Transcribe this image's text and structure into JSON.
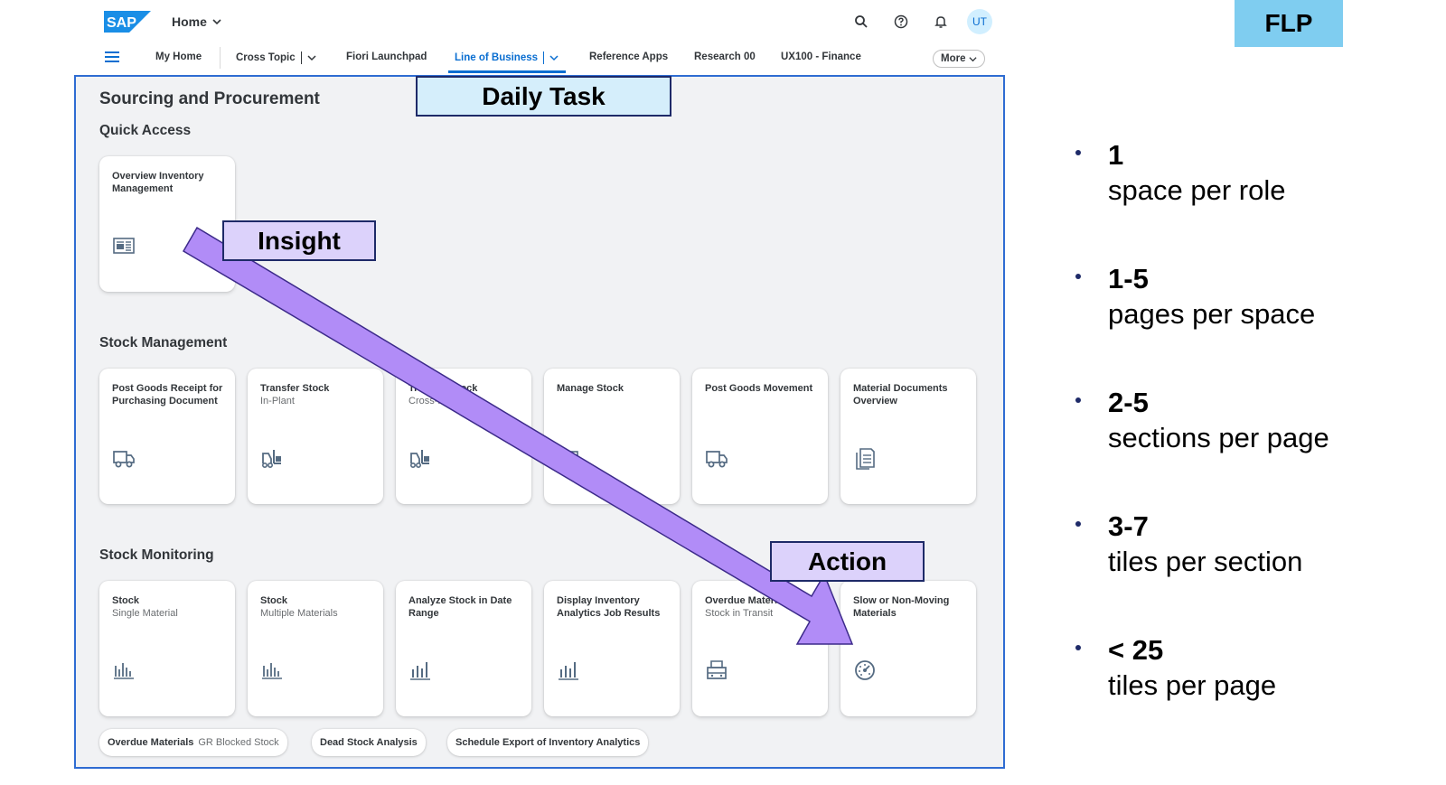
{
  "shell": {
    "logo_text": "SAP",
    "home_label": "Home",
    "avatar_initials": "UT",
    "icons": [
      "search-icon",
      "help-icon",
      "notification-icon"
    ]
  },
  "nav": {
    "items": [
      {
        "label": "My Home"
      },
      {
        "label": "Cross Topic"
      },
      {
        "label": "Fiori Launchpad"
      },
      {
        "label": "Line of Business",
        "active": true
      },
      {
        "label": "Reference Apps"
      },
      {
        "label": "Research 00"
      },
      {
        "label": "UX100 - Finance"
      }
    ],
    "more_label": "More",
    "accent_color": "#0a6ed1"
  },
  "page": {
    "title": "Sourcing and Procurement",
    "sections": [
      {
        "title": "Quick Access",
        "tiles": [
          {
            "title": "Overview Inventory Management",
            "subtitle": "",
            "icon": "document-icon"
          }
        ]
      },
      {
        "title": "Stock Management",
        "tiles": [
          {
            "title": "Post Goods Receipt for Purchasing Document",
            "subtitle": "",
            "icon": "truck-icon"
          },
          {
            "title": "Transfer Stock",
            "subtitle": "In-Plant",
            "icon": "forklift-icon"
          },
          {
            "title": "Transfer Stock",
            "subtitle": "Cross-Plant",
            "icon": "forklift-icon"
          },
          {
            "title": "Manage Stock",
            "subtitle": "",
            "icon": "stock-icon"
          },
          {
            "title": "Post Goods Movement",
            "subtitle": "",
            "icon": "truck-icon"
          },
          {
            "title": "Material Documents Overview",
            "subtitle": "",
            "icon": "documents-icon"
          }
        ]
      },
      {
        "title": "Stock Monitoring",
        "tiles": [
          {
            "title": "Stock",
            "subtitle": "Single Material",
            "icon": "bar-chart-icon"
          },
          {
            "title": "Stock",
            "subtitle": "Multiple Materials",
            "icon": "bar-chart-icon"
          },
          {
            "title": "Analyze Stock in Date Range",
            "subtitle": "",
            "icon": "column-chart-icon"
          },
          {
            "title": "Display Inventory Analytics Job Results",
            "subtitle": "",
            "icon": "column-chart-icon"
          },
          {
            "title": "Overdue Materials",
            "subtitle": "Stock in Transit",
            "icon": "shipping-icon"
          },
          {
            "title": "Slow or Non-Moving Materials",
            "subtitle": "",
            "icon": "gauge-icon"
          }
        ],
        "link_tiles": [
          {
            "title": "Overdue Materials",
            "subtitle": "GR Blocked Stock"
          },
          {
            "title": "Dead Stock Analysis",
            "subtitle": ""
          },
          {
            "title": "Schedule Export of Inventory Analytics",
            "subtitle": ""
          }
        ]
      }
    ]
  },
  "callouts": {
    "daily_task": "Daily Task",
    "insight": "Insight",
    "action": "Action",
    "flp": "FLP",
    "arrow_color": "#b18cf7"
  },
  "stats": [
    {
      "value": "1",
      "label": "space per role"
    },
    {
      "value": "1-5",
      "label": "pages per space"
    },
    {
      "value": "2-5",
      "label": "sections per page"
    },
    {
      "value": "3-7",
      "label": "tiles per section"
    },
    {
      "value": "< 25",
      "label": "tiles per page"
    }
  ]
}
